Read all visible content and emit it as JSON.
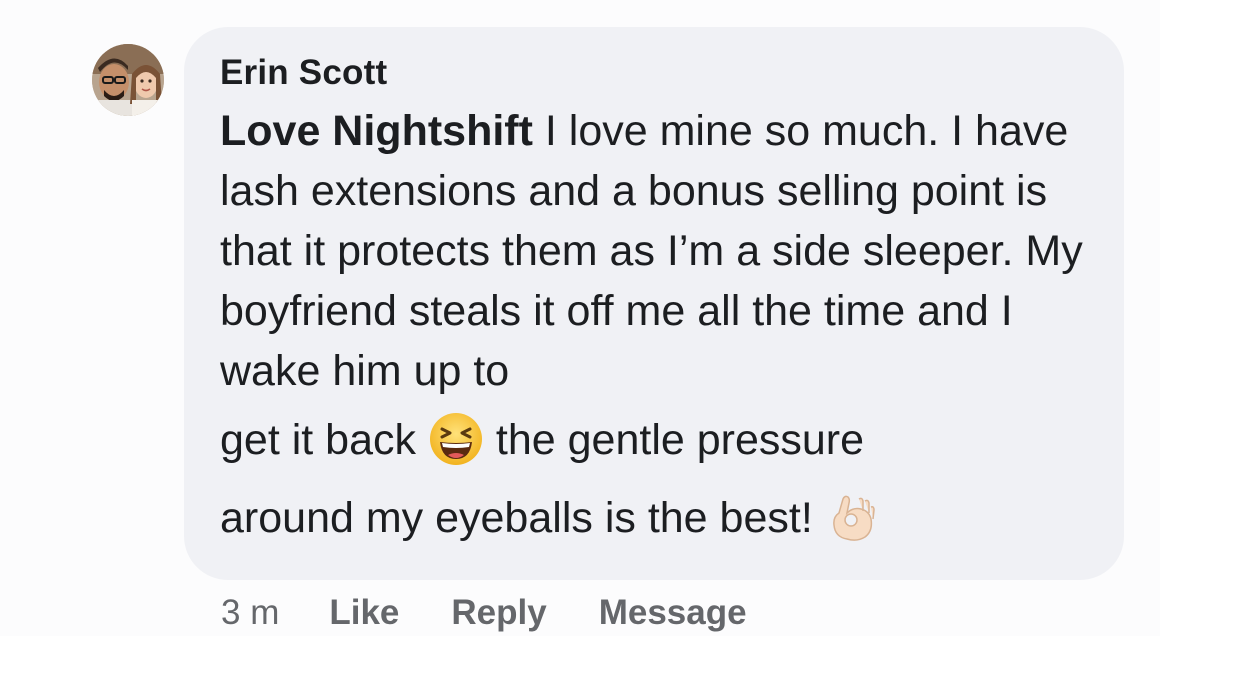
{
  "comment": {
    "author": "Erin Scott",
    "mention": "Love Nightshift",
    "text_part1": " I love mine so much. I have lash extensions and a bonus selling point is that it protects them as I’m a side sleeper. My boyfriend steals it off me all the time and I wake him up to",
    "text_part2": "get it back ",
    "text_part3": " the gentle pressure",
    "text_part4": "around my eyeballs is the best! ",
    "emoji_1": "grinning-squinting-face-emoji",
    "emoji_2": "ok-hand-emoji"
  },
  "actions": {
    "timestamp": "3 m",
    "like_label": "Like",
    "reply_label": "Reply",
    "message_label": "Message"
  },
  "colors": {
    "bubble_bg": "#f0f1f5",
    "text": "#1c1e21",
    "secondary_text": "#65676b"
  }
}
